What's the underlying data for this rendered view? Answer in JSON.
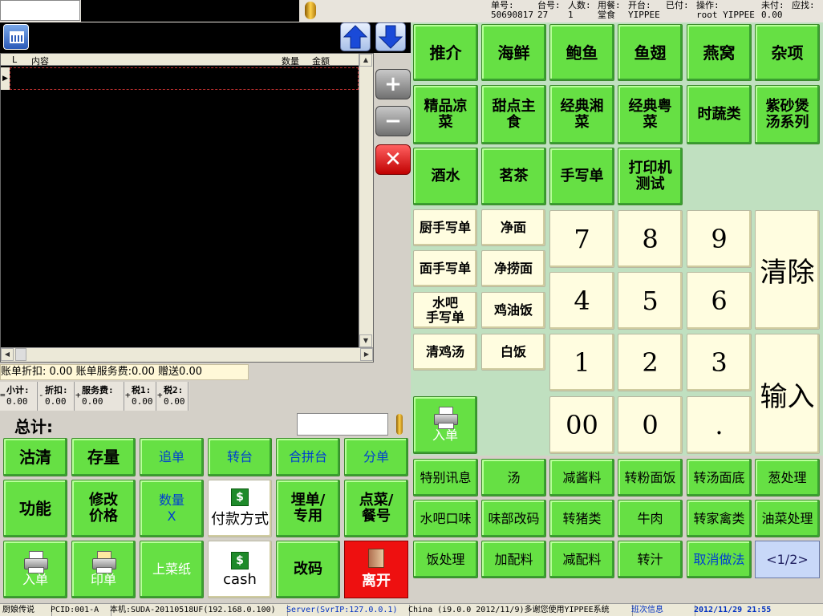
{
  "header": {
    "order_no_label": "单号:",
    "order_no": "50690817",
    "table_label": "台号:",
    "table": "27",
    "people_label": "人数:",
    "people": "1",
    "dining_label": "用餐:",
    "dining": "堂食",
    "opened_label": "开台:",
    "opened_by": "YIPPEE",
    "paid_label": "已付:",
    "paid": "",
    "operator_label": "操作:",
    "operator": "root YIPPEE",
    "unpaid_label": "未付:",
    "unpaid": "0.00",
    "due_label": "应找:",
    "due": ""
  },
  "grid": {
    "columns": [
      "L",
      "内容",
      "数量",
      "金额"
    ]
  },
  "summary": {
    "discount_line": "账单折扣: 0.00 账单服务费:0.00 赠送0.00",
    "subtotal_label": "小计:",
    "subtotal": "0.00",
    "discount_label": "折扣:",
    "discount": "0.00",
    "service_label": "服务费:",
    "service": "0.00",
    "tax1_label": "税1:",
    "tax1": "0.00",
    "tax2_label": "税2:",
    "tax2": "0.00",
    "total_label": "总计:"
  },
  "categories": [
    "推介",
    "海鲜",
    "鲍鱼",
    "鱼翅",
    "燕窝",
    "杂项",
    "精品凉菜",
    "甜点主食",
    "经典湘菜",
    "经典粤菜",
    "时蔬类",
    "紫砂煲汤系列",
    "酒水",
    "茗茶",
    "手写单",
    "打印机测试"
  ],
  "quick_items": [
    "厨手写单",
    "净面",
    "面手写单",
    "净捞面",
    "水吧\n手写单",
    "鸡油饭",
    "清鸡汤",
    "白饭"
  ],
  "keypad": {
    "k7": "7",
    "k8": "8",
    "k9": "9",
    "k4": "4",
    "k5": "5",
    "k6": "6",
    "k1": "1",
    "k2": "2",
    "k3": "3",
    "k00": "00",
    "k0": "0",
    "kdot": ".",
    "clear": "清除",
    "enter": "输入"
  },
  "print_order_label": "入单",
  "modifiers": [
    "特别讯息",
    "汤",
    "减酱料",
    "转粉面饭",
    "转汤面底",
    "葱处理",
    "水吧口味",
    "味部改码",
    "转猪类",
    "牛肉",
    "转家禽类",
    "油菜处理",
    "饭处理",
    "加配料",
    "减配料",
    "转汁",
    "取消做法",
    "<1/2>"
  ],
  "actions": {
    "clear_item": "沽清",
    "stock": "存量",
    "add_order": "追单",
    "transfer_table": "转台",
    "merge_table": "合拼台",
    "split_bill": "分单",
    "function": "功能",
    "modify_price": "修改价格",
    "quantity": "数量X",
    "payment_method": "付款方式",
    "bury_bill": "埋单/专用",
    "order_meal": "点菜/餐号",
    "print_in": "入单",
    "print_bill": "印单",
    "serve_paper": "上菜纸",
    "cash": "cash",
    "change_code": "改码",
    "leave": "离开"
  },
  "status": {
    "app": "厨娘传说",
    "pcid": "PCID:001-A",
    "host": "本机:SUDA-20110518UF(192.168.0.100)",
    "server": "Server(SvrIP:127.0.0.1)",
    "message": "China (i9.0.0 2012/11/9)多谢您使用YIPPEE系统",
    "shift": "班次信息",
    "datetime": "2012/11/29 21:55"
  }
}
